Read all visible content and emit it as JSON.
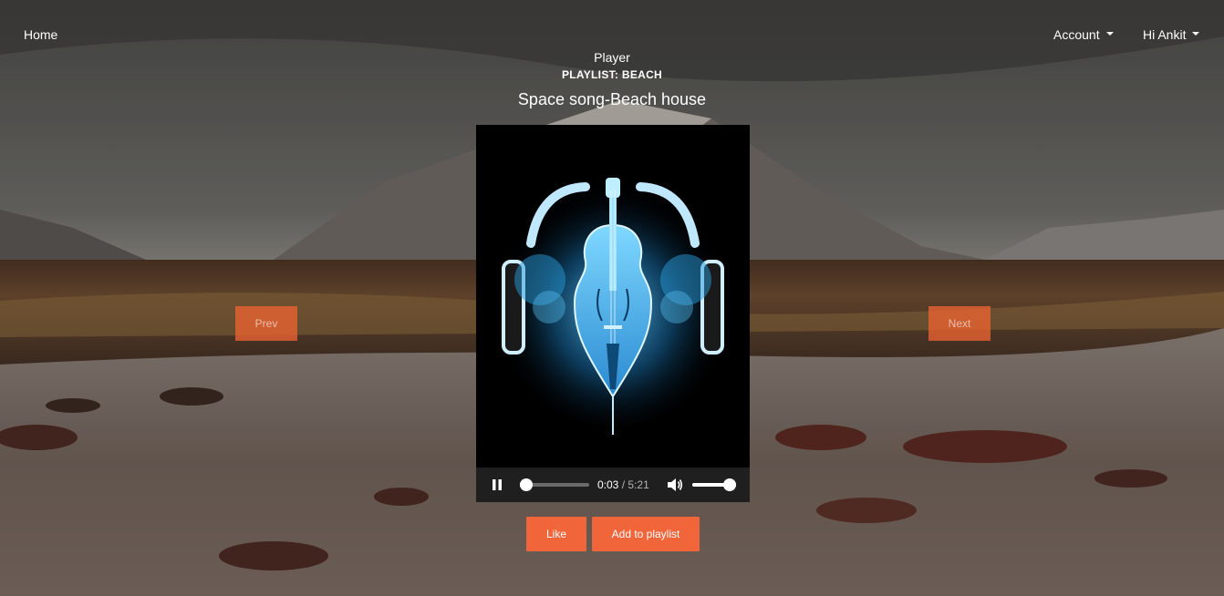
{
  "nav": {
    "home": "Home",
    "account": "Account",
    "user": "Hi Ankit"
  },
  "player": {
    "title": "Player",
    "playlist": "PLAYLIST: BEACH",
    "song": "Space song-Beach house",
    "current_time": "0:03",
    "separator": "/",
    "duration": "5:21",
    "progress_fraction": 0.01,
    "volume_fraction": 1.0,
    "state": "playing"
  },
  "buttons": {
    "prev": "Prev",
    "next": "Next",
    "like": "Like",
    "add_to_playlist": "Add to playlist"
  },
  "colors": {
    "accent": "#f0653a"
  },
  "icons": {
    "pause": "pause-icon",
    "volume": "volume-icon",
    "cover": "cello-headphones-artwork"
  }
}
